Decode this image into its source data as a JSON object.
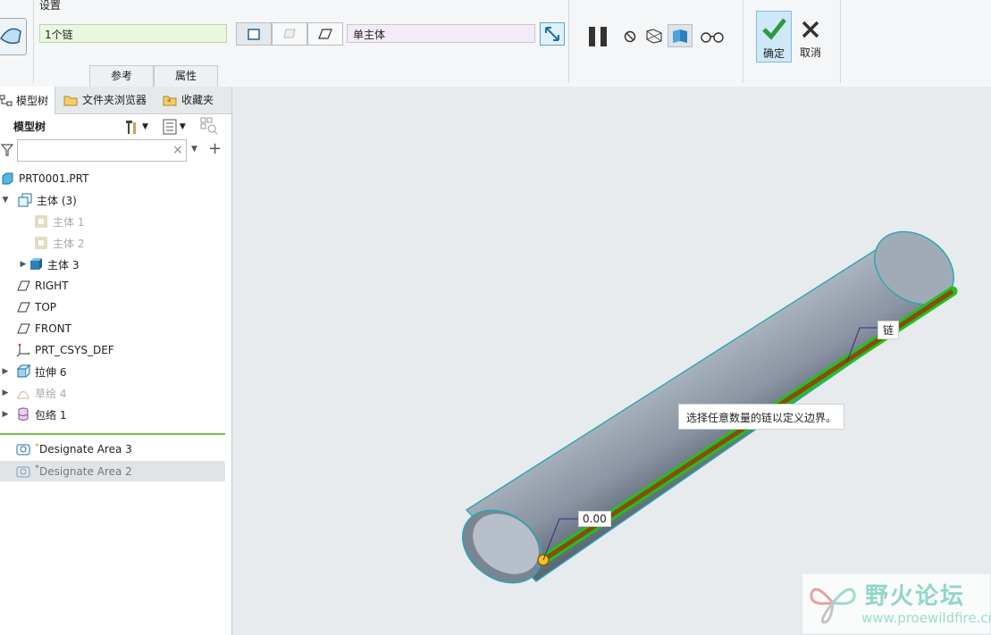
{
  "ribbon": {
    "settings_title": "设置",
    "chain_field_value": "1个链",
    "body_field_value": "单主体",
    "tabs": [
      "参考",
      "属性"
    ],
    "confirm_label": "确定",
    "cancel_label": "取消"
  },
  "left_panel": {
    "tabs": [
      "模型树",
      "文件夹浏览器",
      "收藏夹"
    ],
    "tree_title": "模型树",
    "search_value": "",
    "tree_items": [
      {
        "label": "PRT0001.PRT",
        "icon": "part-icon",
        "dimmed": false
      },
      {
        "label": "主体 (3)",
        "icon": "bodies-icon",
        "dimmed": false
      },
      {
        "label": "主体 1",
        "icon": "body-icon",
        "dimmed": true
      },
      {
        "label": "主体 2",
        "icon": "body-icon",
        "dimmed": true
      },
      {
        "label": "主体 3",
        "icon": "body-solid-icon",
        "dimmed": false
      },
      {
        "label": "RIGHT",
        "icon": "datum-plane-icon",
        "dimmed": false
      },
      {
        "label": "TOP",
        "icon": "datum-plane-icon",
        "dimmed": false
      },
      {
        "label": "FRONT",
        "icon": "datum-plane-icon",
        "dimmed": false
      },
      {
        "label": "PRT_CSYS_DEF",
        "icon": "csys-icon",
        "dimmed": false
      },
      {
        "label": "拉伸 6",
        "icon": "extrude-icon",
        "dimmed": false
      },
      {
        "label": "草绘 4",
        "icon": "sketch-icon",
        "dimmed": true
      },
      {
        "label": "包络 1",
        "icon": "wrap-icon",
        "dimmed": false
      }
    ],
    "designate_areas": [
      {
        "mark": "*",
        "label": "Designate Area 3"
      },
      {
        "mark": "*",
        "label": "Designate Area 2"
      }
    ]
  },
  "viewport": {
    "chain_label": "链",
    "start_value_label": "0.00",
    "tooltip": "选择任意数量的链以定义边界。"
  },
  "watermark": {
    "name": "野火论坛",
    "url": "www.proewildfire.cn"
  },
  "colors": {
    "accent_green": "#76c043",
    "chain_brown": "#8b4a12",
    "highlight_green": "#21c21a",
    "edge_teal": "#2aa6b0"
  }
}
